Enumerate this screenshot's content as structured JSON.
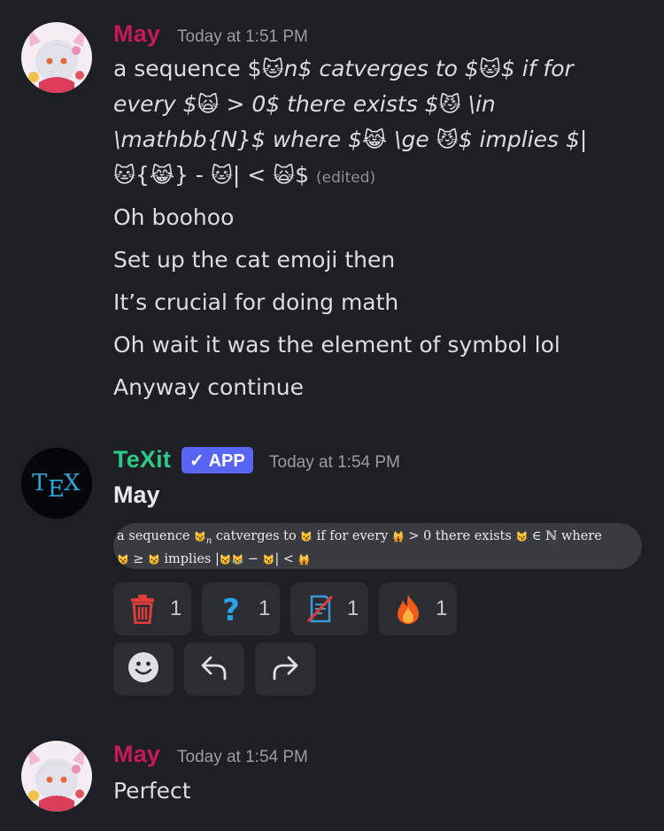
{
  "messages": [
    {
      "author": "May",
      "author_color": "#c4195a",
      "timestamp": "Today at 1:51 PM",
      "line1": {
        "a": "a sequence $",
        "b": "n$ catverges to $",
        "c": "$ if for"
      },
      "line2": {
        "a": "every $",
        "b": " > 0$ there exists $",
        "c": " \\in"
      },
      "line3": {
        "a": "\\mathbb{N}$ where $",
        "b": " \\ge ",
        "c": "$ implies $|"
      },
      "line4": {
        "a": "{",
        "b": "} - ",
        "c": "| < ",
        "d": "$"
      },
      "edited": "(edited)",
      "followups": [
        "Oh boohoo",
        "Set up the cat emoji then",
        "It’s crucial for doing math",
        "Oh wait it was the element of symbol lol",
        "Anyway continue"
      ]
    },
    {
      "author": "TeXit",
      "author_color": "#2eca8a",
      "badge": "✓ APP",
      "badge_color": "#5865f2",
      "timestamp": "Today at 1:54 PM",
      "embed_title": "May",
      "rendered": {
        "r1a": "a sequence ",
        "r1b": "n",
        "r1c": " catverges to ",
        "r1d": " if for every ",
        "r1e": " > 0 there exists ",
        "r1f": " ∈ ℕ where",
        "r2a": " ≥ ",
        "r2b": " implies |",
        "r2c": " − ",
        "r2d": "| < "
      },
      "reactions": [
        {
          "icon": "trash-icon",
          "count": "1"
        },
        {
          "icon": "question-icon",
          "count": "1"
        },
        {
          "icon": "no-document-icon",
          "count": "1"
        },
        {
          "icon": "fire-icon",
          "count": "1"
        }
      ],
      "buttons": [
        "add-reaction",
        "reply",
        "forward"
      ]
    },
    {
      "author": "May",
      "author_color": "#c4195a",
      "timestamp": "Today at 1:54 PM",
      "text": "Perfect"
    }
  ],
  "emoji": {
    "cat": "🐱",
    "scream_cat": "🙀",
    "smirk_cat": "😼",
    "joy_cat": "😹"
  }
}
